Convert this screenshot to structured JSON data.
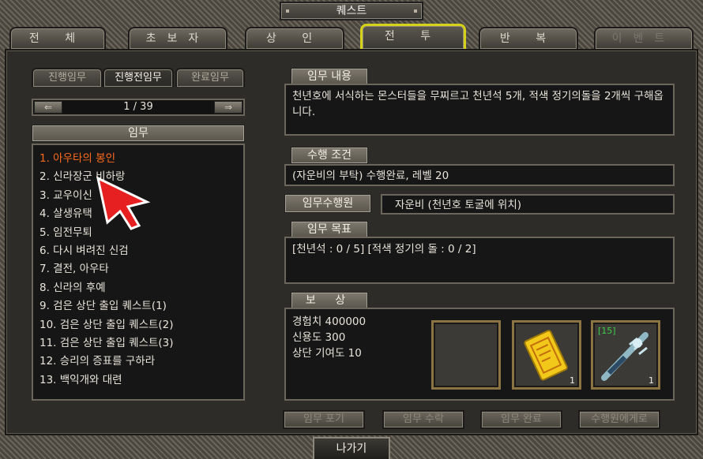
{
  "window": {
    "title": "퀘스트"
  },
  "tabs": [
    {
      "label": "전 체"
    },
    {
      "label": "초보자"
    },
    {
      "label": "상 인"
    },
    {
      "label": "전 투"
    },
    {
      "label": "반 복"
    },
    {
      "label": "이벤트"
    }
  ],
  "subtabs": [
    "진행임무",
    "진행전임무",
    "완료임무"
  ],
  "pager": {
    "text": "1 / 39",
    "prev": "⇐",
    "next": "⇒"
  },
  "quest_list": {
    "header": "임무",
    "items": [
      "1. 아우타의 봉인",
      "2. 신라장군 비하랑",
      "3. 교우이신",
      "4. 살생유택",
      "5. 임전무퇴",
      "6. 다시 벼려진 신검",
      "7. 결전, 아우타",
      "8. 신라의 후예",
      "9. 검은 상단 출입 퀘스트(1)",
      "10. 검은 상단 출입 퀘스트(2)",
      "11. 검은 상단 출입 퀘스트(3)",
      "12. 승리의 증표를 구하라",
      "13. 백익개와 대련"
    ],
    "selected_index": 0
  },
  "details": {
    "content_label": "임무 내용",
    "content_text": "천년호에 서식하는 몬스터들을 무찌르고 천년석 5개, 적색 정기의돌을 2개씩 구해옵니다.",
    "condition_label": "수행 조건",
    "condition_text": "(자운비의 부탁) 수행완료, 레벨 20",
    "npc_label": "임무수행원",
    "npc_text": "자운비 (천년호 토굴에 위치)",
    "goal_label": "임무 목표",
    "goal_text": "[천년석 : 0 / 5] [적색 정기의 돌 : 0 / 2]",
    "reward_label": "보 상",
    "reward_lines": [
      "경험치 400000",
      "신용도 300",
      "상단 기여도 10"
    ],
    "reward_slots": [
      {
        "icon": "empty-slot",
        "qty": ""
      },
      {
        "icon": "scroll-icon",
        "qty": "1"
      },
      {
        "icon": "crossbow-icon",
        "qty": "1",
        "level": "[15]"
      }
    ]
  },
  "actions": [
    "임무 포기",
    "임무 수락",
    "임무 완료",
    "수행원에게로"
  ],
  "footer": {
    "exit": "나가기"
  },
  "colors": {
    "selected_item": "#ff6a1c",
    "active_tab": "#d6d21a",
    "slot_border": "#8b7444"
  }
}
